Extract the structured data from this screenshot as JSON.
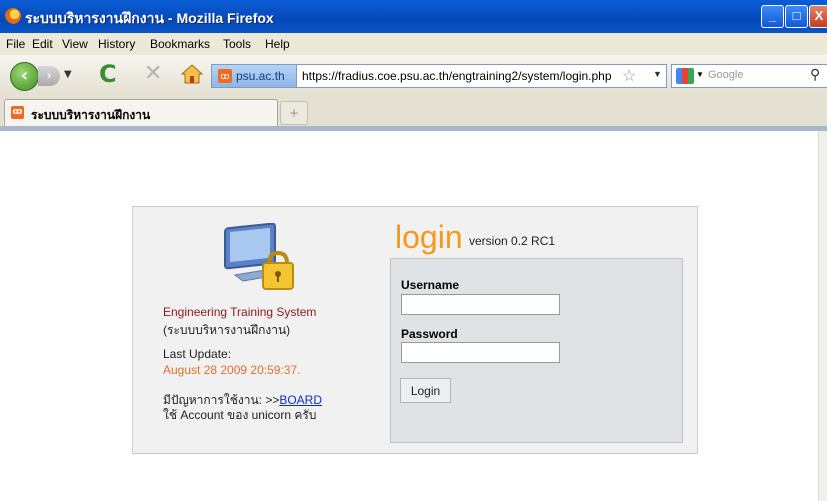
{
  "window": {
    "title": "ระบบบริหารงานฝึกงาน - Mozilla Firefox",
    "controls": {
      "minimize": "_",
      "maximize": "□",
      "close": "X"
    }
  },
  "menu": [
    "File",
    "Edit",
    "View",
    "History",
    "Bookmarks",
    "Tools",
    "Help"
  ],
  "nav": {
    "site_badge": "psu.ac.th",
    "url": "https://fradius.coe.psu.ac.th/engtraining2/system/login.php",
    "search_placeholder": "Google"
  },
  "tabs": [
    {
      "label": "ระบบบริหารงานฝึกงาน"
    }
  ],
  "new_tab_label": "+",
  "sidebar": {
    "system_name": "Engineering Training System",
    "system_name_th": "(ระบบบริหารงานฝึกงาน)",
    "last_update_label": "Last Update:",
    "last_update_value": "August 28 2009 20:59:37.",
    "help_prefix": "มีปัญหาการใช้งาน: >>",
    "help_link": "BOARD",
    "help_note": "ใช้ Account ของ unicorn ครับ"
  },
  "login": {
    "title": "login",
    "version": "version 0.2 RC1",
    "username_label": "Username",
    "password_label": "Password",
    "username_value": "",
    "password_value": "",
    "submit_label": "Login"
  }
}
